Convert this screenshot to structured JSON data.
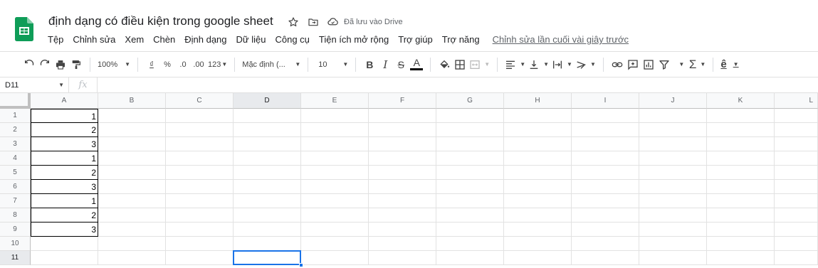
{
  "app": {
    "doc_title": "định dạng có điều kiện trong google sheet",
    "saved_status": "Đã lưu vào Drive",
    "brand_color": "#0f9d58"
  },
  "menu": {
    "items": [
      "Tệp",
      "Chỉnh sửa",
      "Xem",
      "Chèn",
      "Định dạng",
      "Dữ liệu",
      "Công cụ",
      "Tiện ích mở rộng",
      "Trợ giúp",
      "Trợ năng"
    ],
    "last_edit": "Chỉnh sửa lần cuối vài giây trước"
  },
  "toolbar": {
    "zoom": "100%",
    "currency": "₫",
    "percent": "%",
    "decimal_decrease": ".0",
    "decimal_increase": ".00",
    "more_formats": "123",
    "font": "Mặc định (...",
    "font_size": "10",
    "bold": "B",
    "italic": "I",
    "strike": "S",
    "text_color": "A",
    "input_tools": "ê"
  },
  "formula_bar": {
    "name_box": "D11",
    "fx": "fx",
    "value": ""
  },
  "grid": {
    "columns": [
      "A",
      "B",
      "C",
      "D",
      "E",
      "F",
      "G",
      "H",
      "I",
      "J",
      "K",
      "L"
    ],
    "selected_column": "D",
    "rows": [
      "1",
      "2",
      "3",
      "4",
      "5",
      "6",
      "7",
      "8",
      "9",
      "10",
      "11"
    ],
    "selected_row": "11",
    "column_a_values": [
      "1",
      "2",
      "3",
      "1",
      "2",
      "3",
      "1",
      "2",
      "3",
      "",
      ""
    ],
    "active_cell": "D11"
  }
}
